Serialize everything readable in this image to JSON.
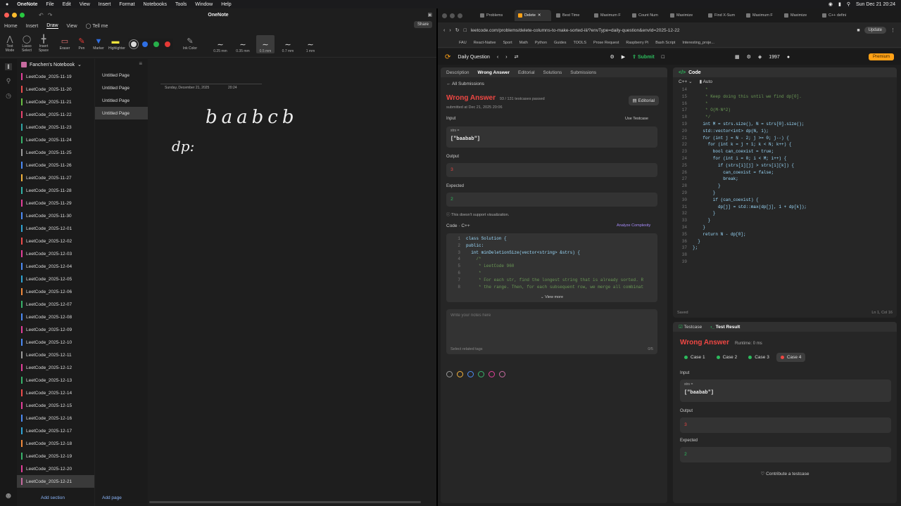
{
  "menubar": {
    "app": "OneNote",
    "items": [
      "File",
      "Edit",
      "View",
      "Insert",
      "Format",
      "Notebooks",
      "Tools",
      "Window",
      "Help"
    ],
    "clock": "Sun Dec 21  20:24"
  },
  "onenote": {
    "title": "OneNote",
    "tabs": [
      "Home",
      "Insert",
      "Draw",
      "View"
    ],
    "tell_me": "Tell me",
    "share": "Share",
    "tools": [
      "Text Mode",
      "Lasso Select",
      "Insert Space",
      "Eraser",
      "Pen",
      "Marker",
      "Highlighter"
    ],
    "ink_color": "Ink Color",
    "pen_colors": [
      "#d9d9d9",
      "#2f6fe4",
      "#27ae4a",
      "#e53935"
    ],
    "widths": [
      "0.25 mm",
      "0.35 mm",
      "0.5 mm",
      "0.7 mm",
      "1 mm"
    ],
    "notebook": "Fanchen's Notebook",
    "sections": [
      {
        "label": "LeetCode_2025-11-19",
        "color": "#e33f9a"
      },
      {
        "label": "LeetCode_2025-11-20",
        "color": "#ec4d4d"
      },
      {
        "label": "LeetCode_2025-11-21",
        "color": "#6ac043"
      },
      {
        "label": "LeetCode_2025-11-22",
        "color": "#e8446e"
      },
      {
        "label": "LeetCode_2025-11-23",
        "color": "#2fa5a5"
      },
      {
        "label": "LeetCode_2025-11-24",
        "color": "#38b36b"
      },
      {
        "label": "LeetCode_2025-11-25",
        "color": "#9c9c9c"
      },
      {
        "label": "LeetCode_2025-11-26",
        "color": "#4c8bf5"
      },
      {
        "label": "LeetCode_2025-11-27",
        "color": "#f3b33d"
      },
      {
        "label": "LeetCode_2025-11-28",
        "color": "#33b3a6"
      },
      {
        "label": "LeetCode_2025-11-29",
        "color": "#e33f9a"
      },
      {
        "label": "LeetCode_2025-11-30",
        "color": "#4c8bf5"
      },
      {
        "label": "LeetCode_2025-12-01",
        "color": "#2fa5d5"
      },
      {
        "label": "LeetCode_2025-12-02",
        "color": "#ec4d4d"
      },
      {
        "label": "LeetCode_2025-12-03",
        "color": "#e33f9a"
      },
      {
        "label": "LeetCode_2025-12-04",
        "color": "#4c8bf5"
      },
      {
        "label": "LeetCode_2025-12-05",
        "color": "#2fa5d5"
      },
      {
        "label": "LeetCode_2025-12-06",
        "color": "#f08a3c"
      },
      {
        "label": "LeetCode_2025-12-07",
        "color": "#38b36b"
      },
      {
        "label": "LeetCode_2025-12-08",
        "color": "#4c8bf5"
      },
      {
        "label": "LeetCode_2025-12-09",
        "color": "#e33f9a"
      },
      {
        "label": "LeetCode_2025-12-10",
        "color": "#4c8bf5"
      },
      {
        "label": "LeetCode_2025-12-11",
        "color": "#9c9c9c"
      },
      {
        "label": "LeetCode_2025-12-12",
        "color": "#e33f9a"
      },
      {
        "label": "LeetCode_2025-12-13",
        "color": "#38b36b"
      },
      {
        "label": "LeetCode_2025-12-14",
        "color": "#ec4d4d"
      },
      {
        "label": "LeetCode_2025-12-15",
        "color": "#e33f9a"
      },
      {
        "label": "LeetCode_2025-12-16",
        "color": "#4c8bf5"
      },
      {
        "label": "LeetCode_2025-12-17",
        "color": "#2fa5d5"
      },
      {
        "label": "LeetCode_2025-12-18",
        "color": "#f08a3c"
      },
      {
        "label": "LeetCode_2025-12-19",
        "color": "#38b36b"
      },
      {
        "label": "LeetCode_2025-12-20",
        "color": "#e33f9a"
      },
      {
        "label": "LeetCode_2025-12-21",
        "color": "#c86ba0"
      }
    ],
    "pages": [
      "Untitled Page",
      "Untitled Page",
      "Untitled Page",
      "Untitled Page"
    ],
    "page_date": "Sunday, December 21, 2025",
    "page_time": "20:24",
    "ink_text_1": "baabcb",
    "ink_text_2": "dp:",
    "add_section": "Add section",
    "add_page": "Add page"
  },
  "browser": {
    "tabs": [
      "Problems",
      "Delete",
      "Best Time",
      "Maximum F",
      "Count Num",
      "Maximize",
      "Find X-Sum",
      "Maximum F",
      "Maximize",
      "C++ defini"
    ],
    "url": "leetcode.com/problems/delete-columns-to-make-sorted-iii/?envType=daily-question&envId=2025-12-22",
    "update": "Update",
    "bookmarks": [
      "FAU",
      "React-Native",
      "Sport",
      "Math",
      "Python",
      "Guides",
      "TOOLS",
      "Prose Request",
      "Raspberry Pi",
      "Bash Script",
      "Interesting_proje..."
    ]
  },
  "leetcode": {
    "daily": "Daily Question",
    "submit": "Submit",
    "streak": "1997",
    "premium": "Premium",
    "left_tabs": [
      "Description",
      "Wrong Answer",
      "Editorial",
      "Solutions",
      "Submissions"
    ],
    "all_submissions": "All Submissions",
    "result": "Wrong Answer",
    "passed": "93 / 131 testcases passed",
    "submitted": "submitted at Dec 21, 2025 20:06",
    "editorial": "Editorial",
    "input_label": "Input",
    "use_testcase": "Use Testcase",
    "var_name": "strs =",
    "input_value": "[\"baabab\"]",
    "output_label": "Output",
    "output_value": "3",
    "expected_label": "Expected",
    "expected_value": "2",
    "no_vis": "This doesn't support visualization.",
    "code_label": "Code",
    "lang": "C++",
    "analyze": "Analyze Complexity",
    "view_more": "View more",
    "notes_placeholder": "Write your notes here",
    "tags_placeholder": "Select related tags",
    "tag_count": "0/5",
    "tag_colors": [
      "#999",
      "#f3b33d",
      "#4c8bf5",
      "#38b36b",
      "#e33f9a",
      "#c86ba0"
    ],
    "snippet": [
      "class Solution {",
      "public:",
      "  int minDeletionSize(vector<string> &strs) {",
      "    /*",
      "     * LeetCode 960",
      "     *",
      "     * For each str, find the longest string that is already sorted. R",
      "     * the range. Then, for each subsequent row, we merge all combinat"
    ],
    "editor_title": "Code",
    "editor_lang": "C++",
    "editor_mode": "Auto",
    "editor_lines": [
      {
        "n": "14",
        "t": "     *",
        "c": true
      },
      {
        "n": "15",
        "t": "     * Keep doing this until we find dp[0].",
        "c": true
      },
      {
        "n": "16",
        "t": "     *",
        "c": true
      },
      {
        "n": "17",
        "t": "     * O(M·N^2)",
        "c": true
      },
      {
        "n": "18",
        "t": "     */",
        "c": true
      },
      {
        "n": "19",
        "t": "    int M = strs.size(), N = strs[0].size();",
        "c": false
      },
      {
        "n": "20",
        "t": "    std::vector<int> dp(N, 1);",
        "c": false
      },
      {
        "n": "21",
        "t": "    for (int j = N - 2; j >= 0; j--) {",
        "c": false
      },
      {
        "n": "22",
        "t": "      for (int k = j + 1; k < N; k++) {",
        "c": false
      },
      {
        "n": "23",
        "t": "        bool can_coexist = true;",
        "c": false
      },
      {
        "n": "24",
        "t": "        for (int i = 0; i < M; i++) {",
        "c": false
      },
      {
        "n": "25",
        "t": "          if (strs[i][j] > strs[i][k]) {",
        "c": false
      },
      {
        "n": "26",
        "t": "            can_coexist = false;",
        "c": false
      },
      {
        "n": "27",
        "t": "            break;",
        "c": false
      },
      {
        "n": "28",
        "t": "          }",
        "c": false
      },
      {
        "n": "29",
        "t": "        }",
        "c": false
      },
      {
        "n": "30",
        "t": "        if (can_coexist) {",
        "c": false
      },
      {
        "n": "31",
        "t": "          dp[j] = std::max(dp[j], 1 + dp[k]);",
        "c": false
      },
      {
        "n": "32",
        "t": "        }",
        "c": false
      },
      {
        "n": "33",
        "t": "      }",
        "c": false
      },
      {
        "n": "34",
        "t": "    }",
        "c": false
      },
      {
        "n": "35",
        "t": "    return N - dp[0];",
        "c": false
      },
      {
        "n": "36",
        "t": "  }",
        "c": false
      },
      {
        "n": "37",
        "t": "};",
        "c": false
      },
      {
        "n": "38",
        "t": "",
        "c": false
      },
      {
        "n": "39",
        "t": "",
        "c": false
      }
    ],
    "saved": "Saved",
    "cursor": "Ln 1, Col 16",
    "test_tabs": [
      "Testcase",
      "Test Result"
    ],
    "test_result": "Wrong Answer",
    "runtime": "Runtime: 0 ms",
    "cases": [
      "Case 1",
      "Case 2",
      "Case 3",
      "Case 4"
    ],
    "contribute": "Contribute a testcase"
  }
}
